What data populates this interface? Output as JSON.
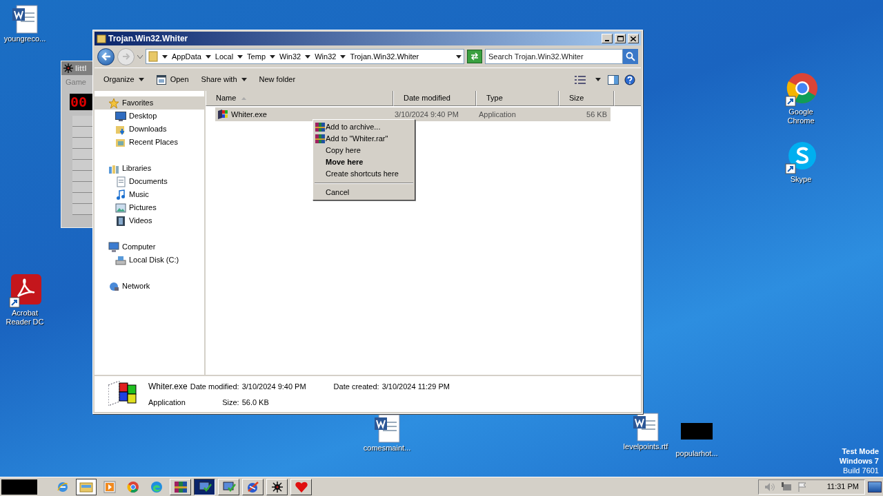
{
  "desktop_icons": [
    {
      "label": "youngreco...",
      "kind": "word"
    },
    {
      "label": "Google Chrome",
      "kind": "chrome"
    },
    {
      "label": "Skype",
      "kind": "skype"
    },
    {
      "label": "Acrobat Reader DC",
      "kind": "acrobat"
    },
    {
      "label": "comesmaint...",
      "kind": "word"
    },
    {
      "label": "levelpoints.rtf",
      "kind": "word"
    },
    {
      "label": "popularhot...",
      "kind": "redacted"
    }
  ],
  "background_window": {
    "title": "littl",
    "menu": "Game",
    "counter": "00"
  },
  "window": {
    "title": "Trojan.Win32.Whiter",
    "breadcrumb": [
      "AppData",
      "Local",
      "Temp",
      "Win32",
      "Win32",
      "Trojan.Win32.Whiter"
    ],
    "search": {
      "placeholder": "Search Trojan.Win32.Whiter"
    },
    "toolbar": [
      {
        "label": "Organize",
        "kind": "menu"
      },
      {
        "label": "Open",
        "kind": "icon"
      },
      {
        "label": "Share with",
        "kind": "menu"
      },
      {
        "label": "New folder",
        "kind": "plain"
      }
    ],
    "nav": [
      {
        "label": "Favorites",
        "kind": "star",
        "selected": true,
        "children": [
          {
            "label": "Desktop",
            "kind": "desktop",
            "selected": false
          },
          {
            "label": "Downloads",
            "kind": "downloads",
            "selected": false
          },
          {
            "label": "Recent Places",
            "kind": "recent",
            "selected": false
          }
        ]
      },
      {
        "label": "Libraries",
        "kind": "library",
        "selected": false,
        "children": [
          {
            "label": "Documents",
            "kind": "documents",
            "selected": false
          },
          {
            "label": "Music",
            "kind": "music",
            "selected": false
          },
          {
            "label": "Pictures",
            "kind": "pictures",
            "selected": false
          },
          {
            "label": "Videos",
            "kind": "videos",
            "selected": false
          }
        ]
      },
      {
        "label": "Computer",
        "kind": "computer",
        "selected": false,
        "children": [
          {
            "label": "Local Disk (C:)",
            "kind": "disk",
            "selected": false
          }
        ]
      },
      {
        "label": "Network",
        "kind": "network",
        "selected": false
      }
    ],
    "columns": [
      "Name",
      "Date modified",
      "Type",
      "Size"
    ],
    "rows": [
      {
        "name": "Whiter.exe",
        "date": "3/10/2024 9:40 PM",
        "type": "Application",
        "size": "56 KB",
        "selected": true
      }
    ],
    "context_menu": [
      {
        "label": "Add to archive...",
        "kind": "icon"
      },
      {
        "label": "Add to \"Whiter.rar\"",
        "kind": "icon"
      },
      {
        "label": "Copy here",
        "kind": "plain"
      },
      {
        "label": "Move here",
        "kind": "bold"
      },
      {
        "label": "Create shortcuts here",
        "kind": "plain"
      },
      {
        "kind": "separator"
      },
      {
        "label": "Cancel",
        "kind": "plain"
      }
    ],
    "details": {
      "name": "Whiter.exe",
      "type": "Application",
      "modified_label": "Date modified:",
      "modified": "3/10/2024 9:40 PM",
      "size_label": "Size:",
      "size": "56.0 KB",
      "created_label": "Date created:",
      "created": "3/10/2024 11:29 PM"
    }
  },
  "test_mode": [
    "Test Mode",
    "Windows 7",
    "Build 7601"
  ],
  "taskbar": {
    "pinned": [
      {
        "kind": "ie",
        "active": false
      },
      {
        "kind": "explorer",
        "active": true
      },
      {
        "kind": "media",
        "active": false
      },
      {
        "kind": "chrome",
        "active": false
      },
      {
        "kind": "edge",
        "active": false
      }
    ],
    "tasks": [
      {
        "kind": "winrar",
        "active": false
      },
      {
        "kind": "monitor",
        "active": true
      },
      {
        "kind": "monitor",
        "active": false
      },
      {
        "kind": "globe",
        "active": false
      },
      {
        "kind": "bug",
        "active": false
      },
      {
        "kind": "heart",
        "active": false
      }
    ],
    "clock": "11:31 PM"
  }
}
